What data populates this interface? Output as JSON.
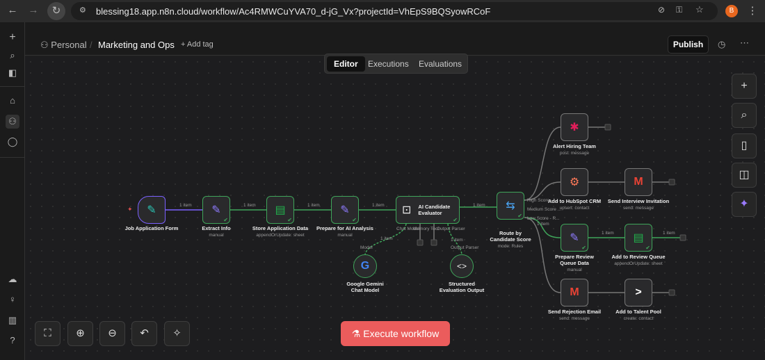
{
  "browser": {
    "url": "blessing18.app.n8n.cloud/workflow/Ac4RMWCuYVA70_d-jG_Vx?projectId=VhEpS9BQSyowRCoF",
    "avatar": "B"
  },
  "header": {
    "project": "Personal",
    "workflow": "Marketing and Ops",
    "add_tag": "+ Add tag",
    "publish": "Publish"
  },
  "tabs": [
    {
      "label": "Editor",
      "active": true
    },
    {
      "label": "Executions"
    },
    {
      "label": "Evaluations"
    }
  ],
  "nodes": {
    "form": {
      "name": "Job Application Form"
    },
    "extract": {
      "name": "Extract Info",
      "sub": "manual"
    },
    "store": {
      "name": "Store Application Data",
      "sub": "appendOrUpdate: sheet"
    },
    "prepare": {
      "name": "Prepare for AI Analysis",
      "sub": "manual"
    },
    "ai": {
      "name": "AI Candidate Evaluator",
      "ports": [
        "Chat Model",
        "Memory",
        "Tool",
        "Output Parser"
      ]
    },
    "route": {
      "name": "Route by Candidate Score",
      "sub": "mode: Rules",
      "outputs": [
        "High Score - I...",
        "Medium Score ...",
        "Low Score - R..."
      ]
    },
    "slack": {
      "name": "Alert Hiring Team",
      "sub": "post: message"
    },
    "hubspot": {
      "name": "Add to HubSpot CRM",
      "sub": "upsert: contact"
    },
    "invite": {
      "name": "Send Interview Invitation",
      "sub": "send: message"
    },
    "review": {
      "name": "Prepare Review Queue Data",
      "sub": "manual"
    },
    "queue": {
      "name": "Add to Review Queue",
      "sub": "appendOrUpdate: sheet"
    },
    "reject": {
      "name": "Send Rejection Email",
      "sub": "send: message"
    },
    "talent": {
      "name": "Add to Talent Pool",
      "sub": "create: contact"
    },
    "gemini": {
      "name": "Google Gemini Chat Model",
      "port": "Model"
    },
    "parser": {
      "name": "Structured Evaluation Output",
      "port": "Output Parser"
    }
  },
  "edge_label": "1 item",
  "execute": "Execute workflow",
  "colors": {
    "success": "#3fa55a",
    "trigger_edge": "#7b61ff",
    "execute": "#eb5c5c"
  }
}
